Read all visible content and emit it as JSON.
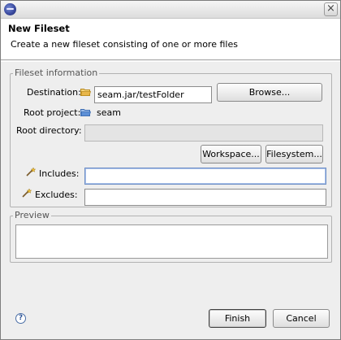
{
  "window": {
    "close_glyph": "×"
  },
  "header": {
    "title": "New Fileset",
    "description": "Create a new fileset consisting of one or more files"
  },
  "fileset_info": {
    "group_label": "Fileset information",
    "destination_label": "Destination:",
    "destination_value": "seam.jar/testFolder",
    "browse_button": "Browse...",
    "root_project_label": "Root project:",
    "root_project_value": "seam",
    "root_directory_label": "Root directory:",
    "root_directory_value": "",
    "workspace_button": "Workspace...",
    "filesystem_button": "Filesystem...",
    "includes_label": "Includes:",
    "includes_value": "",
    "excludes_label": "Excludes:",
    "excludes_value": ""
  },
  "preview": {
    "group_label": "Preview"
  },
  "footer": {
    "help_glyph": "?",
    "finish_button": "Finish",
    "cancel_button": "Cancel"
  },
  "colors": {
    "folder": "#e8b64a",
    "project_folder": "#5c8fd6",
    "focus_border": "#6f8fc5"
  }
}
